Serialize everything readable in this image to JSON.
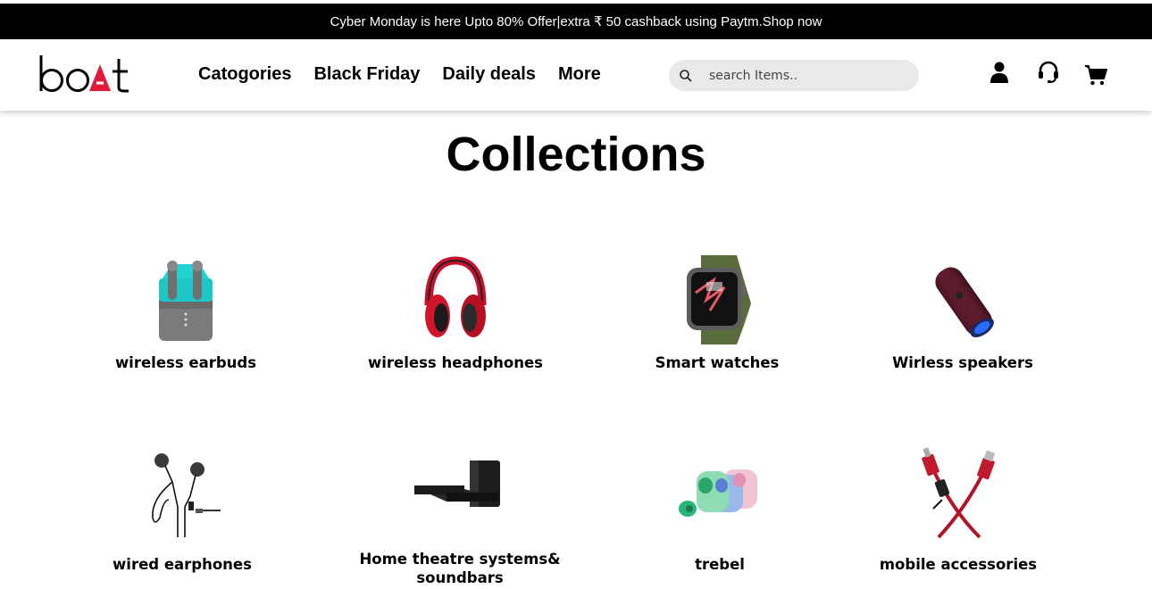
{
  "promo": {
    "text": "Cyber Monday is here Upto 80% Offer|extra ₹ 50 cashback using Paytm.Shop now"
  },
  "header": {
    "logo": "boAt",
    "nav": [
      "Catogories",
      "Black Friday",
      "Daily deals",
      "More"
    ],
    "search": {
      "placeholder": "search Items.."
    },
    "icons": [
      "user-icon",
      "support-headset-icon",
      "cart-icon"
    ]
  },
  "main": {
    "title": "Collections",
    "collections": [
      {
        "label": "wireless earbuds",
        "icon": "earbuds-image"
      },
      {
        "label": "wireless headphones",
        "icon": "headphones-image"
      },
      {
        "label": "Smart watches",
        "icon": "smartwatch-image"
      },
      {
        "label": "Wirless speakers",
        "icon": "speaker-image"
      },
      {
        "label": "wired earphones",
        "icon": "earphones-image"
      },
      {
        "label": "Home theatre systems&",
        "label2": "soundbars",
        "icon": "soundbar-image"
      },
      {
        "label": "trebel",
        "icon": "trebel-earbuds-image"
      },
      {
        "label": "mobile accessories",
        "icon": "cable-image"
      }
    ]
  },
  "colors": {
    "brand_red": "#e11b3c",
    "promo_bg": "#000000",
    "search_bg": "#e9e9e9"
  }
}
